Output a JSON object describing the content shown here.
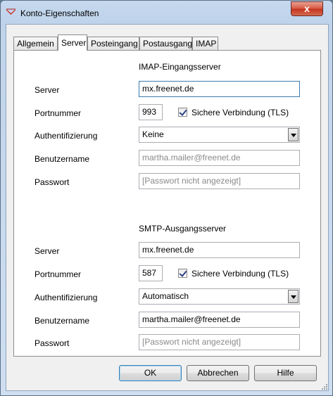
{
  "window": {
    "title": "Konto-Eigenschaften",
    "close_glyph": "x"
  },
  "tabs": [
    {
      "label": "Allgemein"
    },
    {
      "label": "Server"
    },
    {
      "label": "Posteingang"
    },
    {
      "label": "Postausgang"
    },
    {
      "label": "IMAP"
    }
  ],
  "active_tab": "Server",
  "imap": {
    "heading": "IMAP-Eingangsserver",
    "server_label": "Server",
    "server_value": "mx.freenet.de",
    "port_label": "Portnummer",
    "port_value": "993",
    "tls_label": "Sichere Verbindung (TLS)",
    "tls_checked": true,
    "auth_label": "Authentifizierung",
    "auth_value": "Keine",
    "user_label": "Benutzername",
    "user_placeholder": "martha.mailer@freenet.de",
    "pass_label": "Passwort",
    "pass_placeholder": "[Passwort nicht angezeigt]"
  },
  "smtp": {
    "heading": "SMTP-Ausgangsserver",
    "server_label": "Server",
    "server_value": "mx.freenet.de",
    "port_label": "Portnummer",
    "port_value": "587",
    "tls_label": "Sichere Verbindung (TLS)",
    "tls_checked": true,
    "auth_label": "Authentifizierung",
    "auth_value": "Automatisch",
    "user_label": "Benutzername",
    "user_value": "martha.mailer@freenet.de",
    "pass_label": "Passwort",
    "pass_placeholder": "[Passwort nicht angezeigt]"
  },
  "buttons": {
    "ok": "OK",
    "cancel": "Abbrechen",
    "help": "Hilfe"
  },
  "colors": {
    "accent": "#3d7bad",
    "close": "#c4331e",
    "app_icon": "#d12a1f"
  }
}
